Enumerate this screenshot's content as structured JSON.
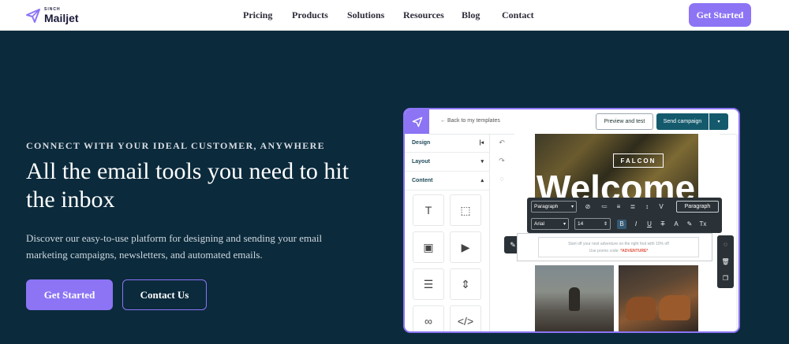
{
  "brand": {
    "sinch": "SINCH",
    "name": "Mailjet",
    "accent": "#8c74f5",
    "hero_bg": "#0b2a3c"
  },
  "nav": {
    "items": [
      "Pricing",
      "Products",
      "Solutions",
      "Resources",
      "Blog",
      "Contact"
    ],
    "cta": "Get Started"
  },
  "hero": {
    "eyebrow": "CONNECT WITH YOUR IDEAL CUSTOMER, ANYWHERE",
    "headline": "All the email tools you need to hit the inbox",
    "description": "Discover our easy-to-use platform for designing and sending your email marketing campaigns, newsletters, and automated emails.",
    "primary_button": "Get Started",
    "secondary_button": "Contact Us"
  },
  "editor": {
    "back_link": "Back to my templates",
    "preview_button": "Preview and test",
    "send_button": "Send campaign",
    "sidebar": {
      "design": "Design",
      "layout": "Layout",
      "content": "Content"
    },
    "tiles": [
      "text-block-icon",
      "image-click-icon",
      "image-icon",
      "video-icon",
      "divider-icon",
      "spacer-icon",
      "social-icon",
      "html-icon"
    ],
    "hero_brand": "FALCON",
    "hero_word": "Welcome",
    "toolbar": {
      "block_type": "Paragraph",
      "font": "Arial",
      "size": "14",
      "style_button": "Paragraph"
    },
    "text_line1": "Start off your next adventure on the right foot with 10% off",
    "text_line2_prefix": "Use promo code: ",
    "promo_code": "*ADVENTURE*"
  }
}
